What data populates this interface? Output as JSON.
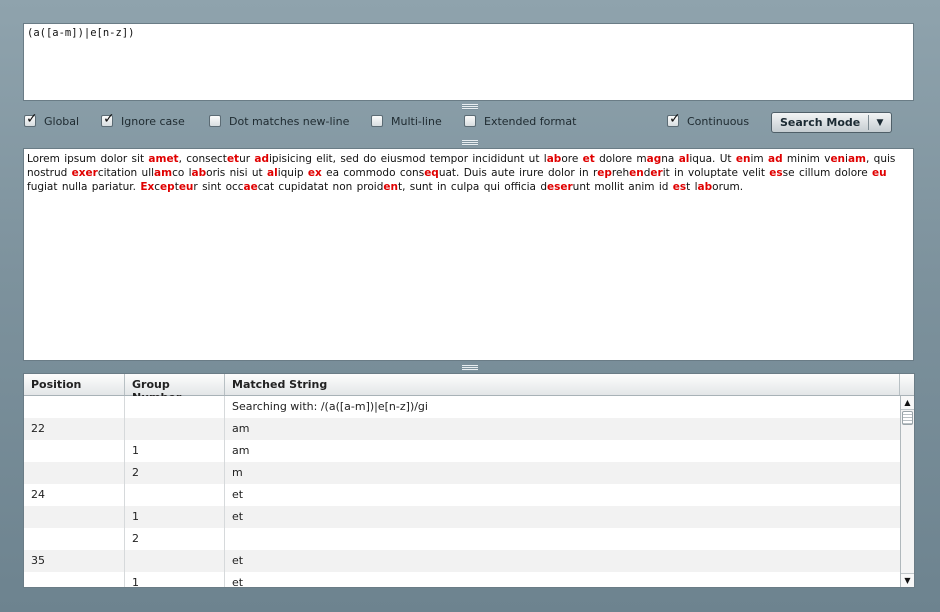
{
  "regex": {
    "value": "(a([a-m])|e[n-z])"
  },
  "options": {
    "global": {
      "label": "Global",
      "checked": true
    },
    "ignore_case": {
      "label": "Ignore case",
      "checked": true
    },
    "dot_newline": {
      "label": "Dot matches new-line",
      "checked": false
    },
    "multiline": {
      "label": "Multi-line",
      "checked": false
    },
    "extended": {
      "label": "Extended format",
      "checked": false
    },
    "continuous": {
      "label": "Continuous",
      "checked": true
    }
  },
  "mode_button": {
    "label": "Search Mode"
  },
  "sample_text": "Lorem ipsum dolor sit amet, consectetur adipisicing elit, sed do eiusmod tempor incididunt ut labore et dolore magna aliqua. Ut enim ad minim veniam, quis nostrud exercitation ullamco laboris nisi ut aliquip ex ea commodo consequat. Duis aute irure dolor in reprehenderit in voluptate velit esse cillum dolore eu fugiat nulla pariatur. Excepteur sint occaecat cupidatat non proident, sunt in culpa qui officia deserunt mollit anim id est laborum.",
  "table": {
    "headers": {
      "position": "Position",
      "group": "Group Number",
      "matched": "Matched String"
    },
    "rows": [
      {
        "position": "",
        "group": "",
        "matched": "Searching with: /(a([a-m])|e[n-z])/gi"
      },
      {
        "position": "22",
        "group": "",
        "matched": "am"
      },
      {
        "position": "",
        "group": "1",
        "matched": "am"
      },
      {
        "position": "",
        "group": "2",
        "matched": "m"
      },
      {
        "position": "24",
        "group": "",
        "matched": "et"
      },
      {
        "position": "",
        "group": "1",
        "matched": "et"
      },
      {
        "position": "",
        "group": "2",
        "matched": ""
      },
      {
        "position": "35",
        "group": "",
        "matched": "et"
      },
      {
        "position": "",
        "group": "1",
        "matched": "et"
      }
    ]
  }
}
